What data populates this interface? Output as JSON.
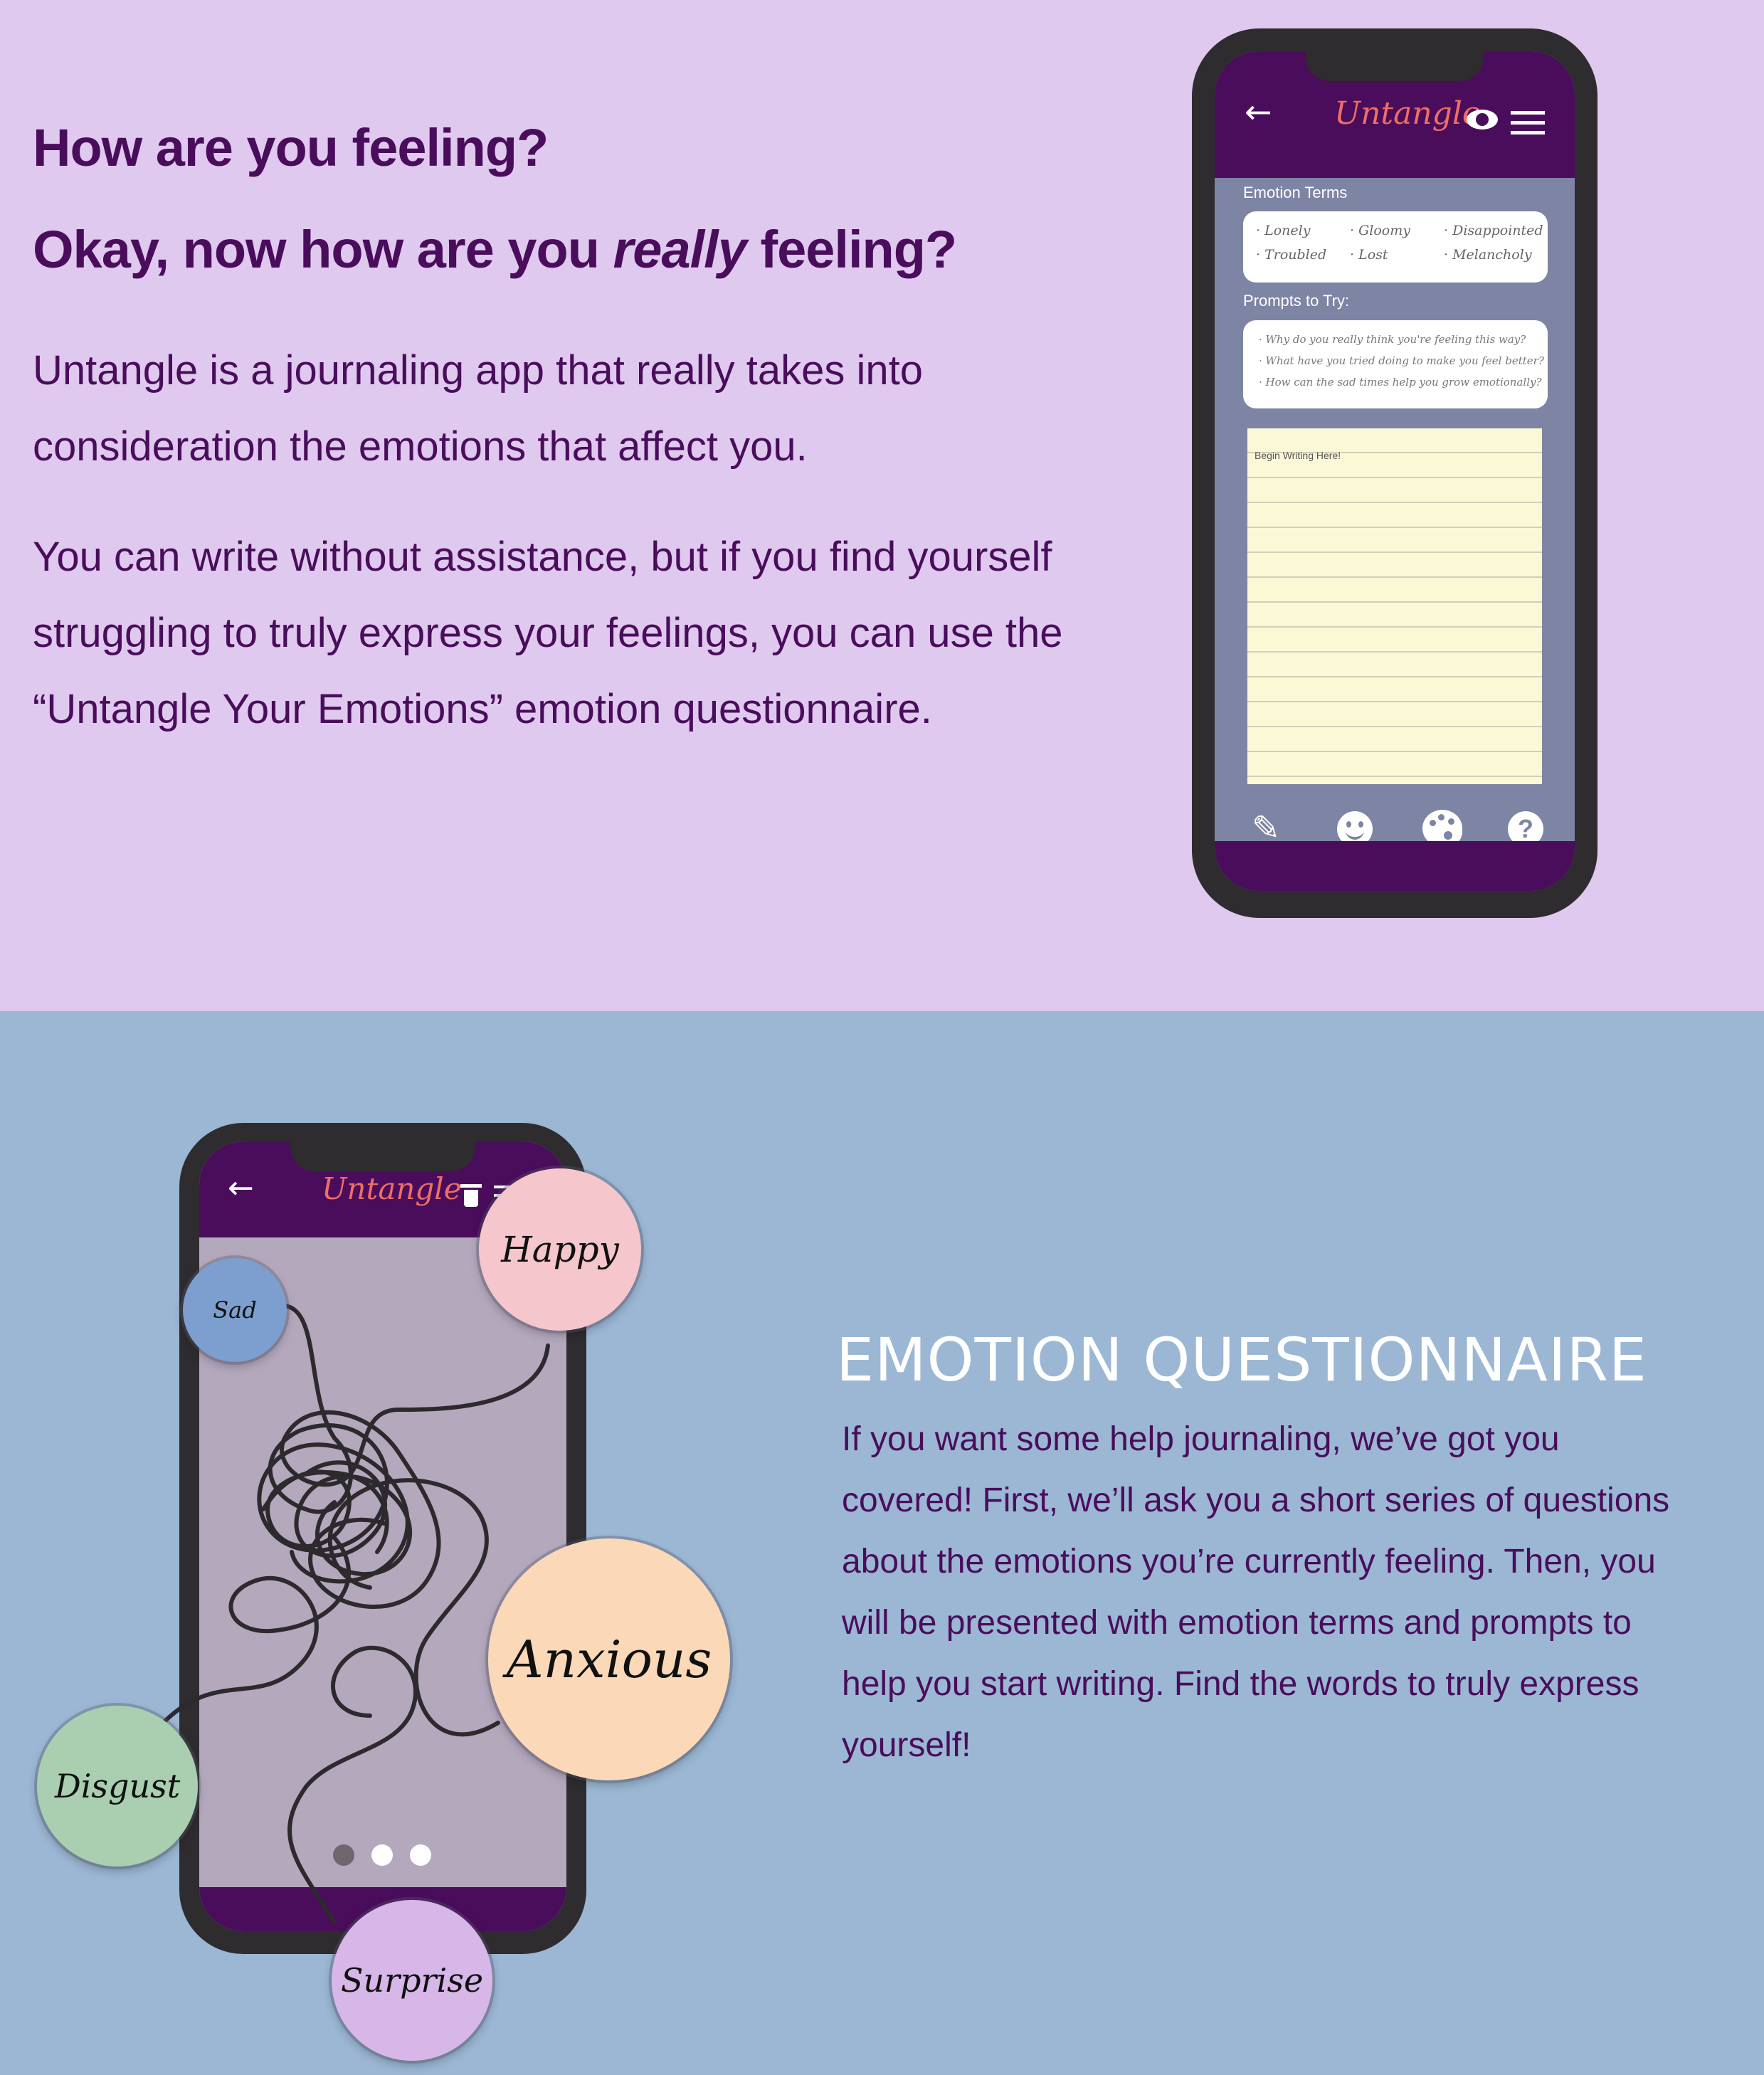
{
  "intro": {
    "heading_line1": "How are you feeling?",
    "heading_line2_prefix": "Okay, now how are you ",
    "heading_line2_emphasis": "really",
    "heading_line2_suffix": " feeling?",
    "paragraph1": "Untangle is a journaling app that really takes into consideration the emotions that affect you.",
    "paragraph2": "You can write without assistance, but if you find yourself struggling to truly express your feelings, you can use the “Untangle Your Emotions” emotion questionnaire."
  },
  "phone1": {
    "app_title": "Untangle",
    "emotion_terms_label": "Emotion Terms",
    "emotion_terms": [
      "· Lonely",
      "· Gloomy",
      "· Disappointed",
      "· Troubled",
      "· Lost",
      "· Melancholy"
    ],
    "prompts_label": "Prompts to Try:",
    "prompts": [
      "· Why do you really think you're feeling this way?",
      "· What have you tried doing to make you feel better?",
      "· How can the sad times help you grow emotionally?"
    ],
    "paper_placeholder": "Begin Writing Here!",
    "icons": {
      "back": "arrow-left-icon",
      "visibility": "eye-icon",
      "menu": "hamburger-menu-icon",
      "write": "pencil-icon",
      "mood": "smiley-icon",
      "theme": "palette-icon",
      "help": "question-icon"
    }
  },
  "phone2": {
    "app_title": "Untangle",
    "icons": {
      "back": "arrow-left-icon",
      "delete": "trash-icon",
      "menu": "hamburger-menu-icon"
    },
    "emotions": [
      {
        "label": "Happy",
        "color": "#f5c6cc"
      },
      {
        "label": "Sad",
        "color": "#7c9fcf"
      },
      {
        "label": "Anxious",
        "color": "#fbd9b8"
      },
      {
        "label": "Disgust",
        "color": "#a9cfb0"
      },
      {
        "label": "Surprise",
        "color": "#d7b6e8"
      }
    ],
    "pagination": {
      "total": 3,
      "active": 1
    }
  },
  "questionnaire": {
    "title": "EMOTION QUESTIONNAIRE",
    "body": "If you want some help journaling, we’ve got you covered! First, we’ll ask you a short series of questions about the emotions you’re currently feeling. Then, you will be presented with emotion terms and prompts to help you start writing. Find the words to truly express yourself!"
  },
  "colors": {
    "section1_bg": "#e0c9ee",
    "section2_bg": "#9bb7d4",
    "heading_text": "#4a0d5c",
    "app_bar": "#4a0d5c",
    "logo": "#ef6e64"
  }
}
